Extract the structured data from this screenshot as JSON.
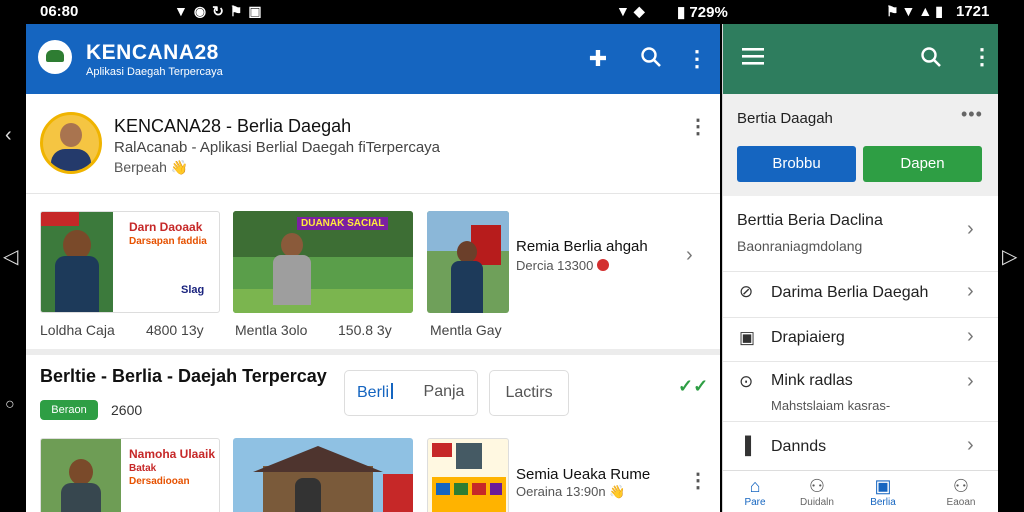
{
  "status_bar": {
    "time_left": "06:80",
    "icons_left": "▼◉↻⚑▣",
    "icons_mid": "▼◆",
    "battery": "▮ 729%",
    "icons_right": "⚑▼▲▮",
    "time_right": "1721"
  },
  "app": {
    "brand": "KENCANA28",
    "brand_subtitle": "Aplikasi Daegah Terpercaya"
  },
  "profile": {
    "title": "KENCANA28   - Berlia Daegah",
    "subtitle": "RalAcanab - Aplikasi Berlial Daegah fiTerpercaya",
    "line3": "Berpeah",
    "line3_emoji": "👋"
  },
  "feed_row_1": {
    "thumbs": [
      {
        "heading": "Darn Daoaak",
        "subheading": "Darsapan faddia",
        "corner": "Slag",
        "caption_left": "Loldha Caja",
        "caption_right": "4800  13y"
      },
      {
        "banner": "DUANAK SACIAL",
        "caption_left": "Mentla 3olo",
        "caption_right": "150.8  3y"
      },
      {
        "caption_left": "Mentla Gay"
      }
    ],
    "news_title": "Remia Berlia ahgah",
    "news_sub": "Dercia 13300"
  },
  "section": {
    "title": "Berltie  - Berlia - Daejah Terpercay",
    "badge": "Beraon",
    "number": "2600",
    "tab_active": "Berli",
    "tab_2": "Panja",
    "tab_3": "Lactirs"
  },
  "feed_row_2": {
    "thumbs": [
      {
        "heading": "Namoha Ulaaik",
        "subheading": "Batak",
        "line3": "Dersadiooan"
      },
      {},
      {}
    ],
    "news_title": "Semia Ueaka Rume",
    "news_sub": "Oeraina 13:90n"
  },
  "right_panel": {
    "title": "Bertia Daagah",
    "btn_blue": "Brobbu",
    "btn_green": "Dapen",
    "items": [
      {
        "label": "Berttia Beria Daclina",
        "sub": "Baonraniagmdolang"
      },
      {
        "label": "Darima Berlia Daegah",
        "icon": "⊘"
      },
      {
        "label": "Drapiaierg",
        "icon": "▣"
      },
      {
        "label": "Mink radlas",
        "sub": "Mahstslaiam kasras-",
        "icon": "⊙"
      },
      {
        "label": "Dannds",
        "icon": "▐"
      }
    ],
    "bottom_nav": [
      {
        "label": "Pare",
        "icon": "⌂"
      },
      {
        "label": "Duidaln",
        "icon": "⚇"
      },
      {
        "label": "Berlia",
        "icon": "▣"
      },
      {
        "label": "Eaoan",
        "icon": "⚇"
      }
    ]
  },
  "colors": {
    "primary_blue": "#1565c0",
    "teal_green": "#2e7d5e",
    "accent_green": "#2e9e44"
  }
}
